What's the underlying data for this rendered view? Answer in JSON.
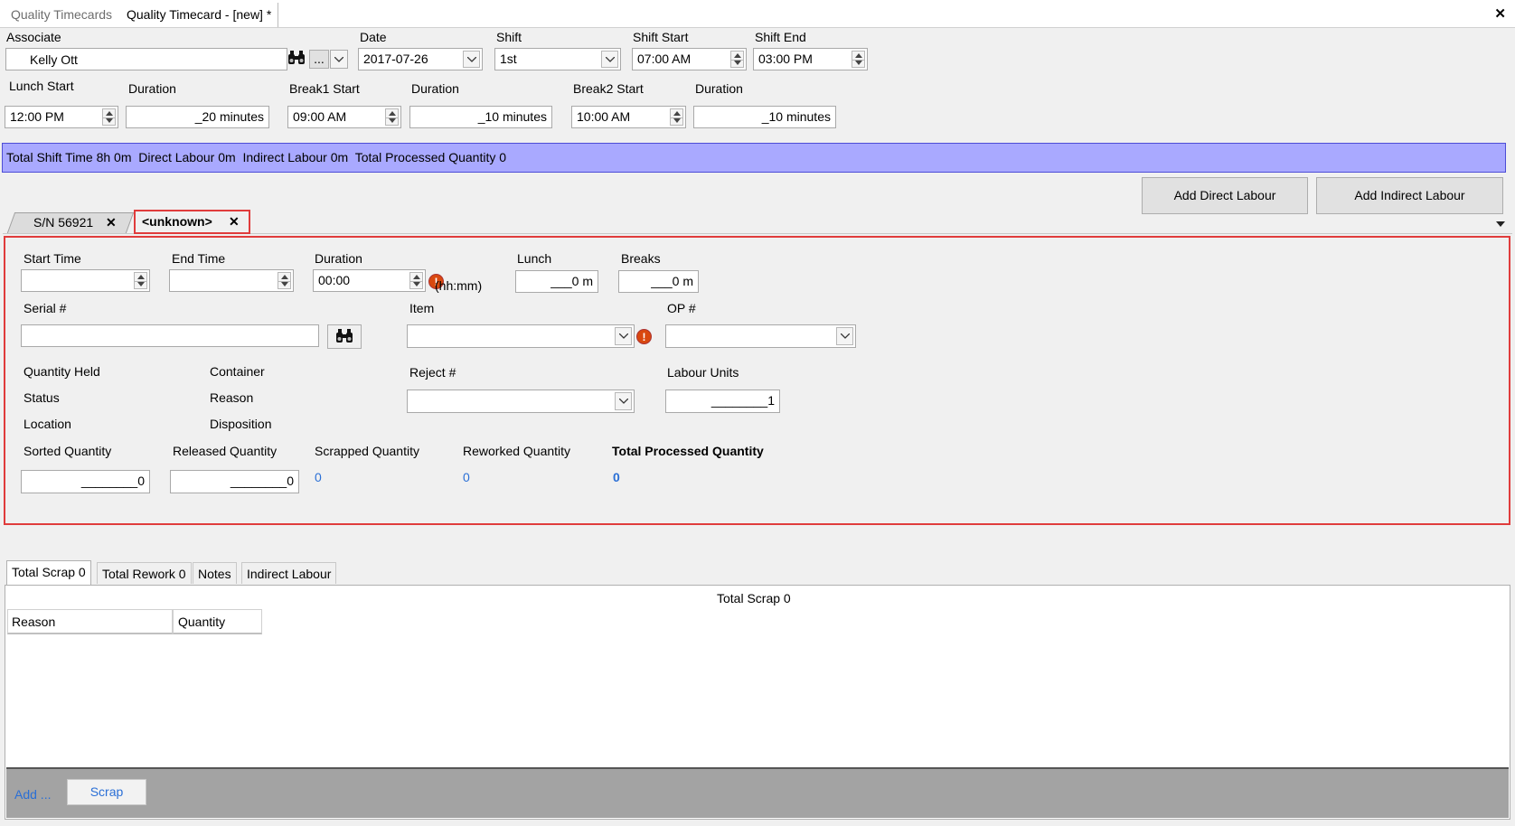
{
  "doc_tabs": {
    "tab1": "Quality Timecards",
    "tab2": "Quality Timecard - [new] *",
    "close": "✕"
  },
  "header": {
    "associate_label": "Associate",
    "associate_value": "Kelly Ott",
    "ellipsis": "...",
    "date_label": "Date",
    "date_value": "2017-07-26",
    "shift_label": "Shift",
    "shift_value": "1st",
    "shift_start_label": "Shift Start",
    "shift_start_value": "07:00 AM",
    "shift_end_label": "Shift End",
    "shift_end_value": "03:00 PM",
    "lunch_start_label": "Lunch Start",
    "lunch_start_value": "12:00 PM",
    "lunch_duration_label": "Duration",
    "lunch_duration_value": "_20 minutes",
    "break1_start_label": "Break1 Start",
    "break1_start_value": "09:00 AM",
    "break1_duration_label": "Duration",
    "break1_duration_value": "_10 minutes",
    "break2_start_label": "Break2 Start",
    "break2_start_value": "10:00 AM",
    "break2_duration_label": "Duration",
    "break2_duration_value": "_10 minutes"
  },
  "summary_bar": "Total Shift Time 8h 0m  Direct Labour 0m  Indirect Labour 0m  Total Processed Quantity 0",
  "buttons": {
    "add_direct": "Add Direct Labour",
    "add_indirect": "Add Indirect Labour"
  },
  "labour_tabs": [
    {
      "label": "S/N 56921",
      "close": "✕"
    },
    {
      "label": "<unknown>",
      "close": "✕"
    }
  ],
  "detail": {
    "start_time_label": "Start Time",
    "end_time_label": "End Time",
    "duration_label": "Duration",
    "duration_value": "00:00",
    "duration_unit": "(hh:mm)",
    "lunch_label": "Lunch",
    "lunch_value": "___0 m",
    "breaks_label": "Breaks",
    "breaks_value": "___0 m",
    "serial_label": "Serial #",
    "item_label": "Item",
    "op_label": "OP #",
    "quantity_held_label": "Quantity Held",
    "container_label": "Container",
    "status_label": "Status",
    "reason_label": "Reason",
    "location_label": "Location",
    "disposition_label": "Disposition",
    "reject_label": "Reject #",
    "labour_units_label": "Labour Units",
    "labour_units_value": "________1",
    "sorted_qty_label": "Sorted Quantity",
    "sorted_qty_value": "________0",
    "released_qty_label": "Released Quantity",
    "released_qty_value": "________0",
    "scrapped_qty_label": "Scrapped Quantity",
    "scrapped_qty_value": "0",
    "reworked_qty_label": "Reworked Quantity",
    "reworked_qty_value": "0",
    "total_processed_label": "Total Processed Quantity",
    "total_processed_value": "0"
  },
  "bottom_tabs": [
    "Total Scrap 0",
    "Total Rework 0",
    "Notes",
    "Indirect Labour"
  ],
  "scrap_panel": {
    "title": "Total Scrap 0",
    "columns": [
      "Reason",
      "Quantity"
    ],
    "add_label": "Add ...",
    "scrap_button": "Scrap"
  },
  "colors": {
    "summary_bg": "#a9a9ff",
    "highlight_border": "#e03c3c",
    "link_blue": "#2a6fd6"
  }
}
